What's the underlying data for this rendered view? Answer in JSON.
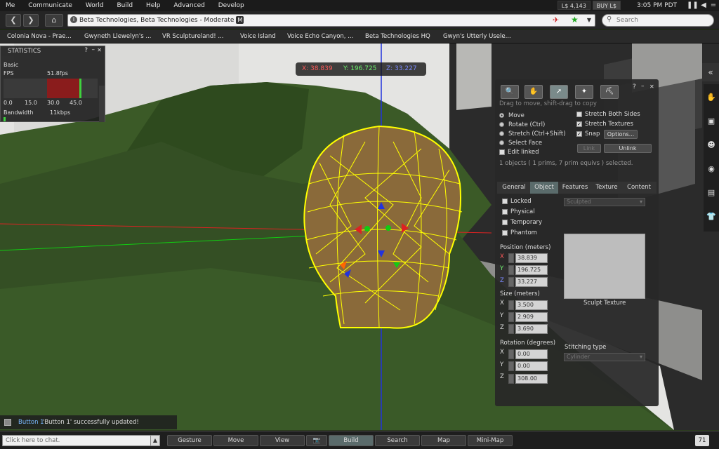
{
  "menu": [
    "Me",
    "Communicate",
    "World",
    "Build",
    "Help",
    "Advanced",
    "Develop"
  ],
  "balance": {
    "amount": "L$ 4,143",
    "buy": "BUY L$"
  },
  "clock": "3:05 PM PDT",
  "navbar": {
    "location": "Beta Technologies, Beta Technologies - Moderate",
    "maturity_badge": "M",
    "search_placeholder": "Search"
  },
  "favorites": [
    "Colonia Nova - Prae...",
    "Gwyneth Llewelyn's ...",
    "VR Sculptureland! ...",
    "Voice Island",
    "Voice Echo Canyon, ...",
    "Beta Technologies HQ",
    "Gwyn's Utterly Usele..."
  ],
  "statistics": {
    "title": "STATISTICS",
    "section": "Basic",
    "fps_label": "FPS",
    "fps_value": "51.8fps",
    "scale": [
      "0.0",
      "15.0",
      "30.0",
      "45.0"
    ],
    "bandwidth_label": "Bandwidth",
    "bandwidth_value": "11kbps"
  },
  "coords": {
    "x": "X: 38.839",
    "y": "Y: 196.725",
    "z": "Z: 33.227"
  },
  "build": {
    "hint": "Drag to move, shift-drag to copy",
    "modes": [
      "Move",
      "Rotate (Ctrl)",
      "Stretch (Ctrl+Shift)",
      "Select Face"
    ],
    "edit_linked": "Edit linked",
    "stretch_both": "Stretch Both Sides",
    "stretch_textures": "Stretch Textures",
    "snap": "Snap",
    "options": "Options...",
    "link": "Link",
    "unlink": "Unlink",
    "selection_info": "1 objects ( 1 prims, 7 prim equivs ) selected.",
    "tabs": [
      "General",
      "Object",
      "Features",
      "Texture",
      "Content"
    ],
    "flags": [
      "Locked",
      "Physical",
      "Temporary",
      "Phantom"
    ],
    "sculpted": "Sculpted",
    "position_label": "Position (meters)",
    "size_label": "Size (meters)",
    "rotation_label": "Rotation (degrees)",
    "axes": [
      "X",
      "Y",
      "Z"
    ],
    "position": [
      "38.839",
      "196.725",
      "33.227"
    ],
    "size": [
      "3.500",
      "2.909",
      "3.690"
    ],
    "rotation": [
      "0.00",
      "0.00",
      "308.00"
    ],
    "sculpt_texture": "Sculpt Texture",
    "stitching_label": "Stitching type",
    "stitching_value": "Cylinder"
  },
  "notification": {
    "prefix": "Button 1",
    "message": " 'Button 1' successfully updated!"
  },
  "bottombar": {
    "chat_placeholder": "Click here to chat.",
    "buttons": [
      "Gesture",
      "Move",
      "View",
      "Build",
      "Search",
      "Map",
      "Mini-Map"
    ],
    "badge": "71"
  },
  "colors": {
    "wireframe": "#ffff00",
    "accent": "#5a6b6b"
  }
}
